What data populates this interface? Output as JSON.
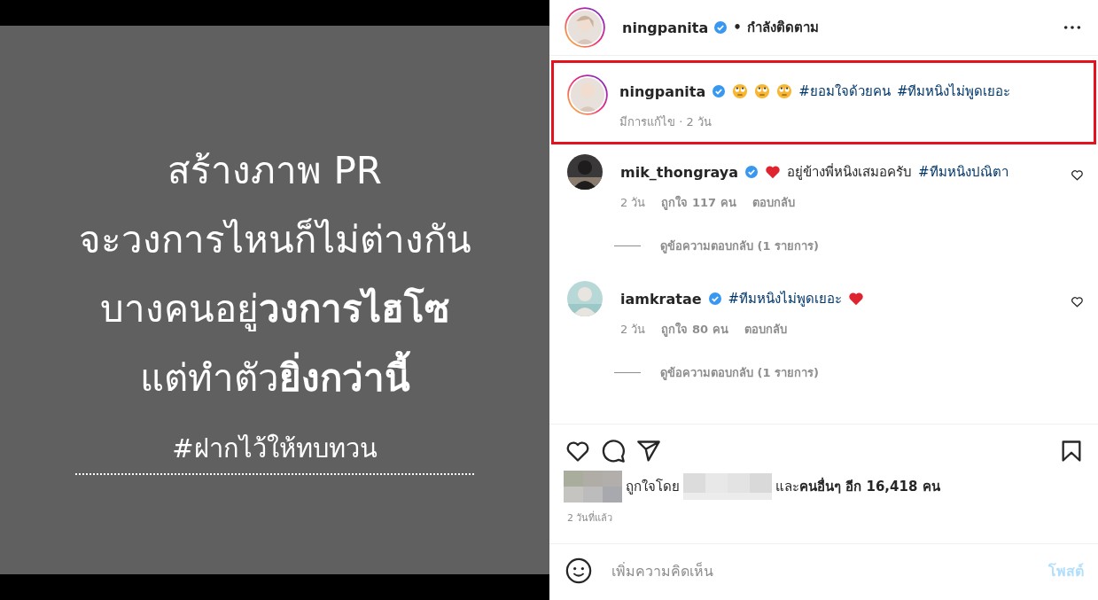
{
  "post_image": {
    "lines": [
      "สร้างภาพ PR",
      "จะวงการไหนก็ไม่ต่างกัน",
      "บางคนอยู่**วงการไฮโซ**",
      "แต่ทำตัว**ยิ่งกว่านี้**"
    ],
    "hashtag": "#ฝากไว้ให้ทบทวน"
  },
  "header": {
    "username": "ningpanita",
    "verified": true,
    "separator": "•",
    "following": "กำลังติดตาม"
  },
  "caption": {
    "username": "ningpanita",
    "verified": true,
    "highlighted": true,
    "meta": "มีการแก้ไข · 2 วัน",
    "parts": [
      {
        "kind": "emoji"
      },
      {
        "kind": "emoji"
      },
      {
        "kind": "emoji"
      },
      {
        "kind": "hashtag",
        "text": "#ยอมใจด้วยคน"
      },
      {
        "kind": "hashtag",
        "text": "#ทีมหนิงไม่พูดเยอะ"
      }
    ]
  },
  "comments": [
    {
      "username": "mik_thongraya",
      "verified": true,
      "parts": [
        {
          "kind": "heart"
        },
        {
          "kind": "text",
          "text": "อยู่ข้างพี่หนิงเสมอครับ"
        },
        {
          "kind": "hashtag",
          "text": "#ทีมหนิงปณิตา"
        }
      ],
      "time": "2 วัน",
      "likes": "ถูกใจ 117 คน",
      "reply": "ตอบกลับ",
      "view_replies": "ดูข้อความตอบกลับ (1 รายการ)"
    },
    {
      "username": "iamkratae",
      "verified": true,
      "parts": [
        {
          "kind": "hashtag",
          "text": "#ทีมหนิงไม่พูดเยอะ"
        },
        {
          "kind": "heart"
        }
      ],
      "time": "2 วัน",
      "likes": "ถูกใจ 80 คน",
      "reply": "ตอบกลับ",
      "view_replies": "ดูข้อความตอบกลับ (1 รายการ)"
    }
  ],
  "liked_by": {
    "prefix": "ถูกใจโดย",
    "suffix": "และ**คนอื่นๆ อีก 16,418 คน**"
  },
  "timestamp": "2 วันที่แล้ว",
  "comment_box": {
    "placeholder": "เพิ่มความคิดเห็น",
    "post": "โพสต์",
    "post_disabled": true
  }
}
